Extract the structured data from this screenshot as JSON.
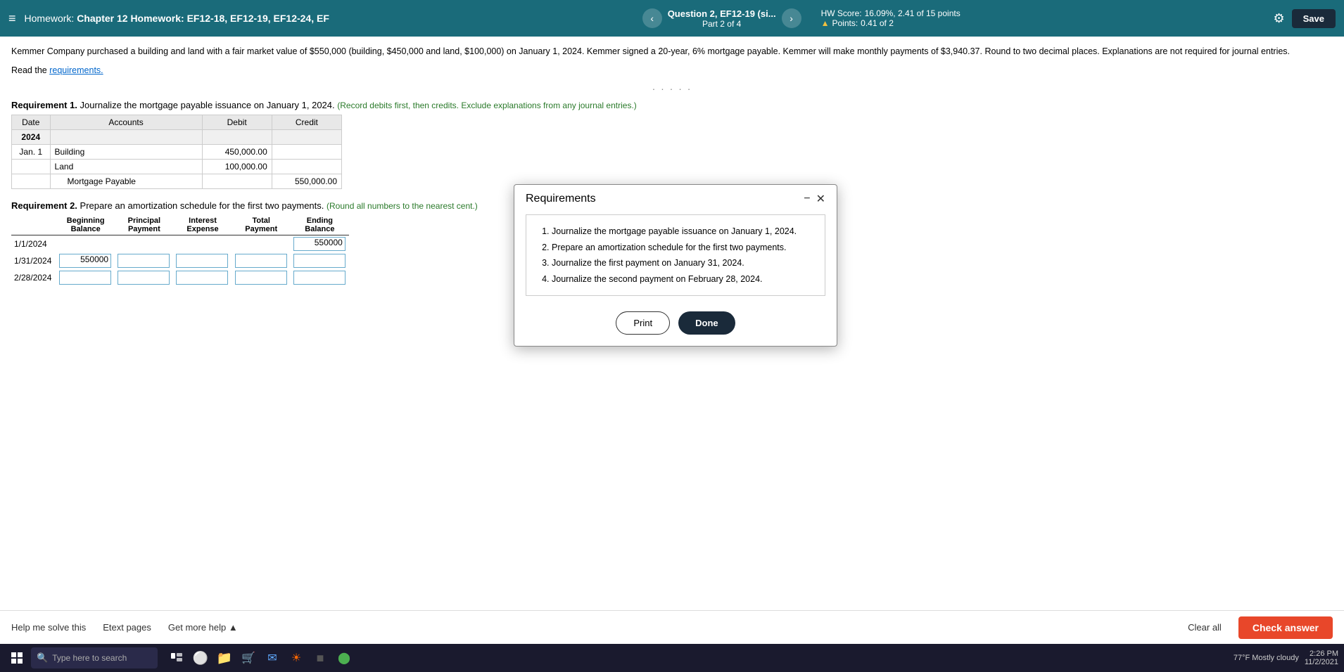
{
  "nav": {
    "hamburger": "≡",
    "title_prefix": "Homework: ",
    "title": "Chapter 12 Homework: EF12-18, EF12-19, EF12-24, EF",
    "question_title": "Question 2, EF12-19 (si...",
    "question_part": "Part 2 of 4",
    "hw_score_label": "HW Score:",
    "hw_score_value": "16.09%, 2.41 of 15 points",
    "points_label": "Points:",
    "points_value": "0.41 of 2",
    "save_label": "Save"
  },
  "problem": {
    "text": "Kemmer Company purchased a building and land with a fair market value of $550,000 (building, $450,000 and land, $100,000) on January 1, 2024. Kemmer signed a 20-year, 6% mortgage payable. Kemmer will make monthly payments of $3,940.37. Round to two decimal places. Explanations are not required for journal entries.",
    "read_requirements": "Read the",
    "requirements_link": "requirements."
  },
  "req1": {
    "label": "Requirement 1.",
    "label_text": "Journalize the mortgage payable issuance on January 1, 2024.",
    "note": "(Record debits first, then credits. Exclude explanations from any journal entries.)",
    "table": {
      "headers": [
        "Date",
        "Accounts",
        "Debit",
        "Credit"
      ],
      "rows": [
        {
          "date": "2024",
          "account": "",
          "debit": "",
          "credit": "",
          "is_year": true
        },
        {
          "date": "Jan. 1",
          "account": "Building",
          "debit": "450,000.00",
          "credit": "",
          "indented": false
        },
        {
          "date": "",
          "account": "Land",
          "debit": "100,000.00",
          "credit": "",
          "indented": false
        },
        {
          "date": "",
          "account": "Mortgage Payable",
          "debit": "",
          "credit": "550,000.00",
          "indented": true
        }
      ]
    }
  },
  "req2": {
    "label": "Requirement 2.",
    "label_text": "Prepare an amortization schedule for the first two payments.",
    "note": "(Round all numbers to the nearest cent.)",
    "table": {
      "headers": [
        "",
        "Beginning\nBalance",
        "Principal\nPayment",
        "Interest\nExpense",
        "Total\nPayment",
        "Ending\nBalance"
      ],
      "rows": [
        {
          "date": "1/1/2024",
          "beginning": "",
          "principal": "",
          "interest": "",
          "total": "",
          "ending": "550000",
          "ending_filled": true
        },
        {
          "date": "1/31/2024",
          "beginning": "550000",
          "principal": "",
          "interest": "",
          "total": "",
          "ending": "",
          "beginning_filled": true
        },
        {
          "date": "2/28/2024",
          "beginning": "",
          "principal": "",
          "interest": "",
          "total": "",
          "ending": ""
        }
      ]
    }
  },
  "dialog": {
    "title": "Requirements",
    "items": [
      "Journalize the mortgage payable issuance on January 1, 2024.",
      "Prepare an amortization schedule for the first two payments.",
      "Journalize the first payment on January 31, 2024.",
      "Journalize the second payment on February 28, 2024."
    ],
    "print_label": "Print",
    "done_label": "Done"
  },
  "toolbar": {
    "help_label": "Help me solve this",
    "etext_label": "Etext pages",
    "get_more_label": "Get more help ▲",
    "clear_label": "Clear all",
    "check_label": "Check answer"
  },
  "taskbar": {
    "search_placeholder": "Type here to search",
    "weather": "77°F  Mostly cloudy",
    "time": "2:26 PM",
    "date": "11/2/2021"
  }
}
